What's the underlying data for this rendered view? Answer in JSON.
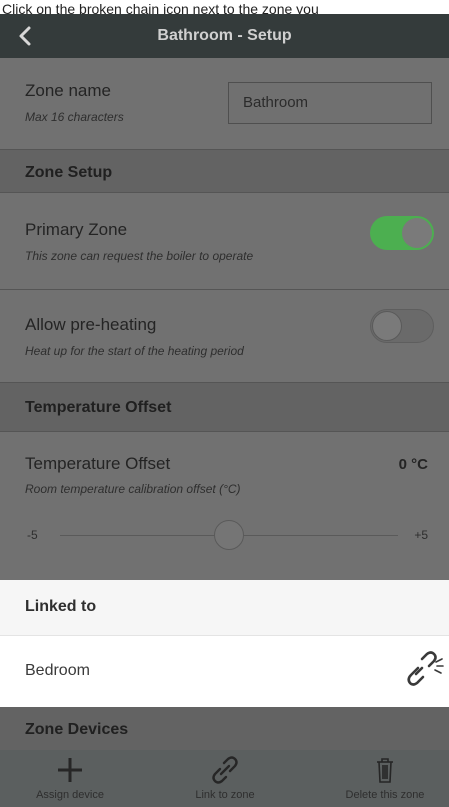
{
  "instruction": "Click on the broken chain icon next to the zone you",
  "header": {
    "title": "Bathroom - Setup",
    "back_icon": "chevron-left-icon"
  },
  "zone_name": {
    "label": "Zone name",
    "hint": "Max 16 characters",
    "value": "Bathroom"
  },
  "zone_setup": {
    "heading": "Zone Setup",
    "primary": {
      "label": "Primary Zone",
      "description": "This zone can request the boiler to operate",
      "enabled": true
    },
    "preheat": {
      "label": "Allow pre-heating",
      "description": "Heat up for the start of the heating period",
      "enabled": false
    }
  },
  "temperature": {
    "heading": "Temperature Offset",
    "label": "Temperature Offset",
    "description": "Room temperature calibration offset (°C)",
    "value_text": "0 °C",
    "min_label": "-5",
    "max_label": "+5",
    "min": -5,
    "max": 5,
    "value": 0
  },
  "linked": {
    "heading": "Linked to",
    "zones": [
      {
        "name": "Bedroom",
        "icon": "broken-chain-icon"
      }
    ]
  },
  "devices": {
    "heading": "Zone Devices"
  },
  "bottom_actions": [
    {
      "label": "Assign device",
      "icon": "plus-icon"
    },
    {
      "label": "Link to zone",
      "icon": "chain-link-icon"
    },
    {
      "label": "Delete this zone",
      "icon": "trash-icon"
    }
  ],
  "colors": {
    "toggle_on": "#4CAF50",
    "topbar": "#343b3b",
    "overlay_bg": "#717171"
  }
}
